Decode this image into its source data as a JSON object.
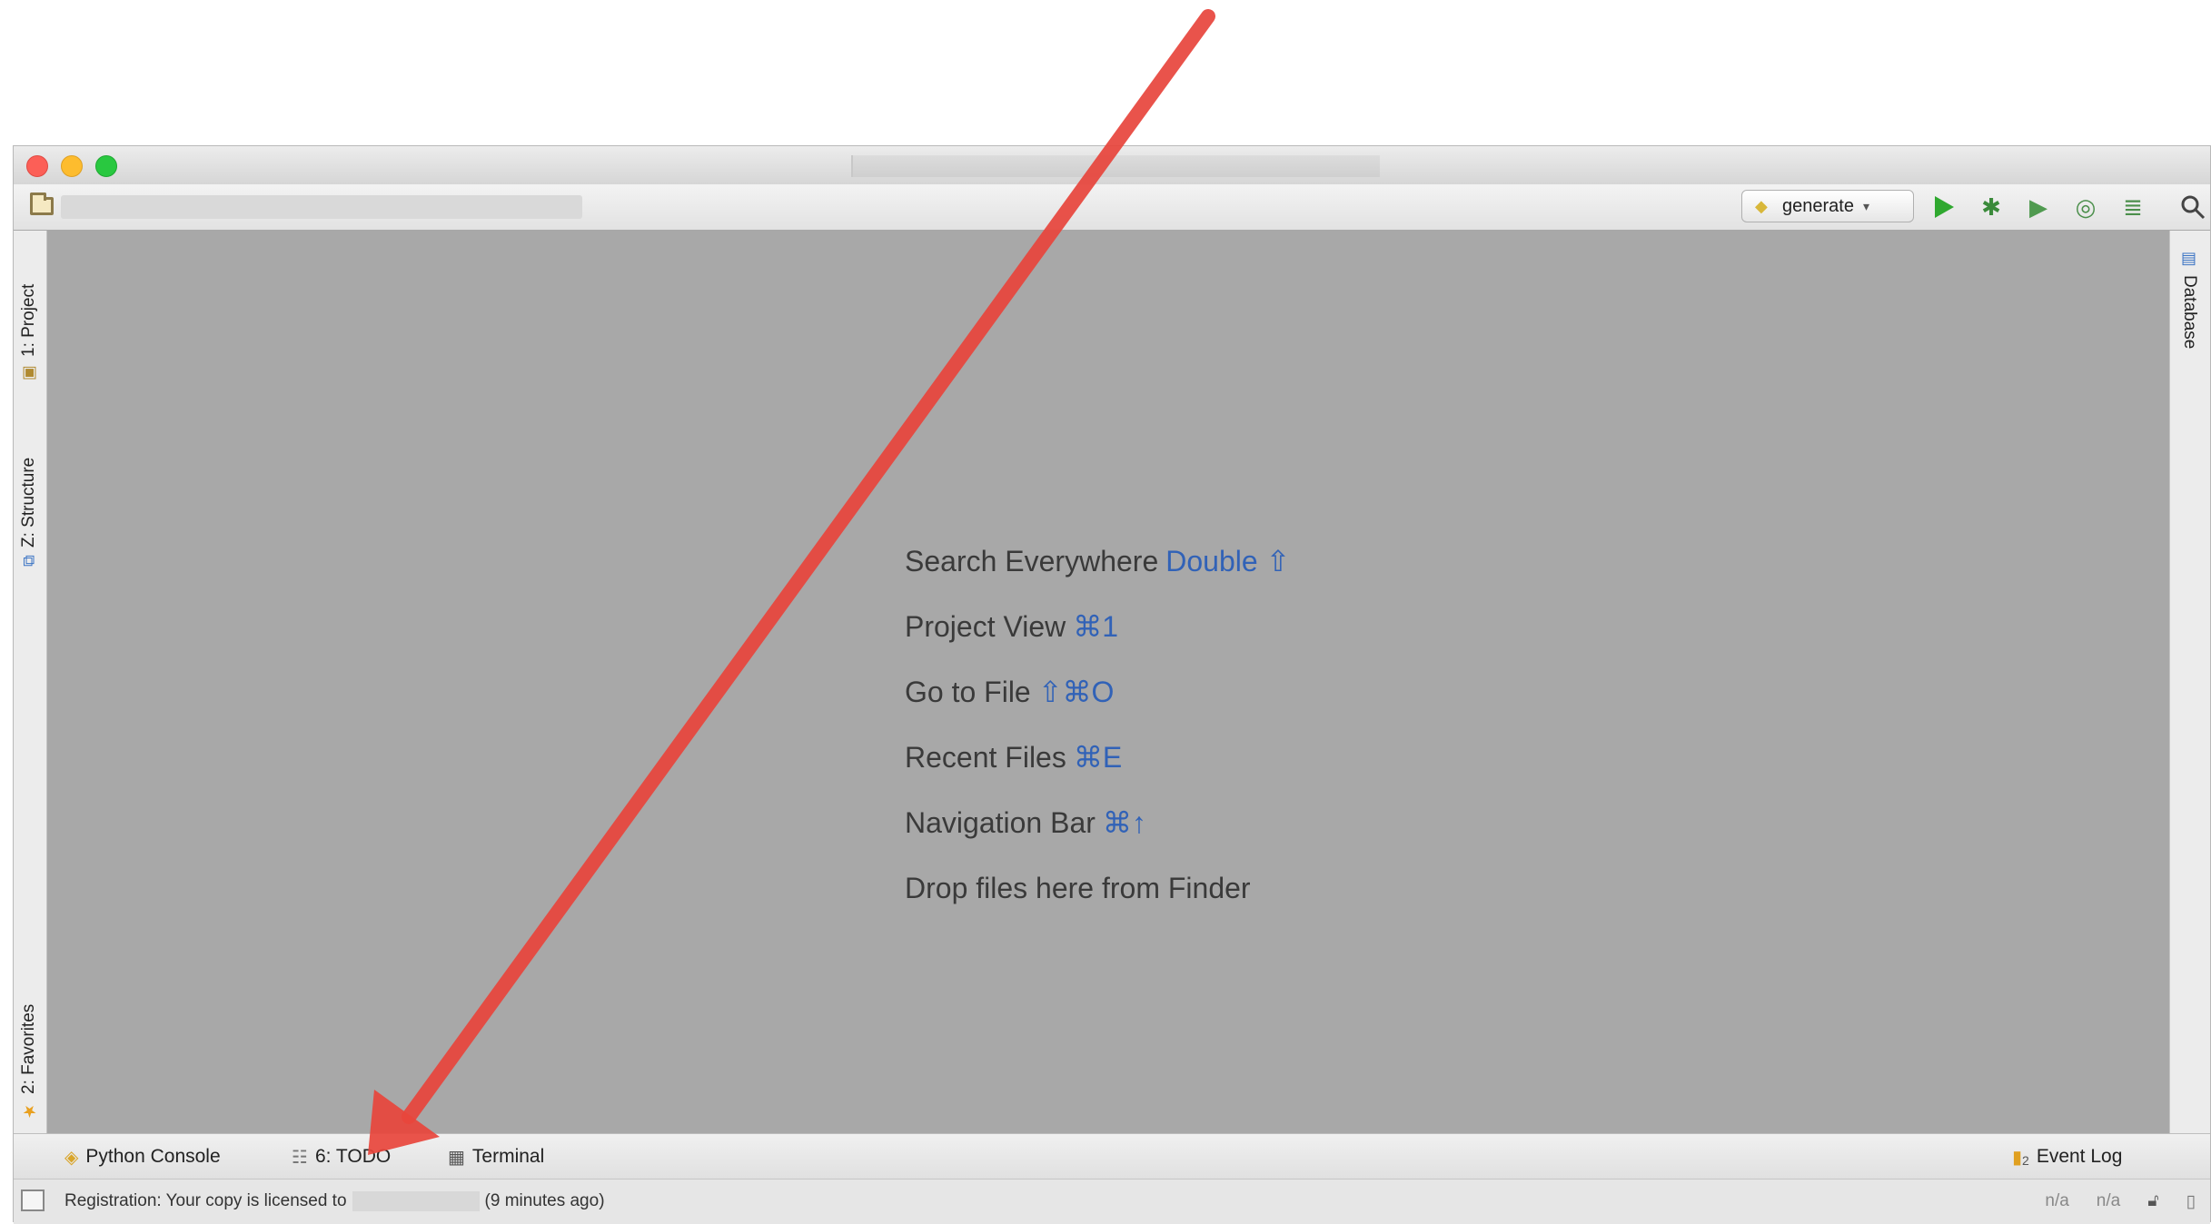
{
  "run_config": {
    "label": "generate"
  },
  "left_tabs": {
    "project": "1: Project",
    "structure": "Z: Structure",
    "favorites": "2: Favorites"
  },
  "right_tabs": {
    "database": "Database"
  },
  "hints": [
    {
      "text": "Search Everywhere",
      "key": "Double ⇧"
    },
    {
      "text": "Project View",
      "key": "⌘1"
    },
    {
      "text": "Go to File",
      "key": "⇧⌘O"
    },
    {
      "text": "Recent Files",
      "key": "⌘E"
    },
    {
      "text": "Navigation Bar",
      "key": "⌘↑"
    },
    {
      "text": "Drop files here from Finder",
      "key": ""
    }
  ],
  "bottom_tabs": {
    "python_console": "Python Console",
    "todo": "6: TODO",
    "terminal": "Terminal",
    "event_log": "Event Log",
    "event_log_count": "2"
  },
  "status": {
    "message_prefix": "Registration: Your copy is licensed to",
    "message_suffix": "(9 minutes ago)",
    "pos1": "n/a",
    "pos2": "n/a"
  },
  "colors": {
    "annotation_arrow": "#e8453c",
    "hint_key": "#3162b7",
    "editor_bg": "#a8a8a8"
  },
  "icons": {
    "folder": "folder-icon",
    "run": "run-icon",
    "debug": "debug-icon",
    "search": "search-icon"
  }
}
